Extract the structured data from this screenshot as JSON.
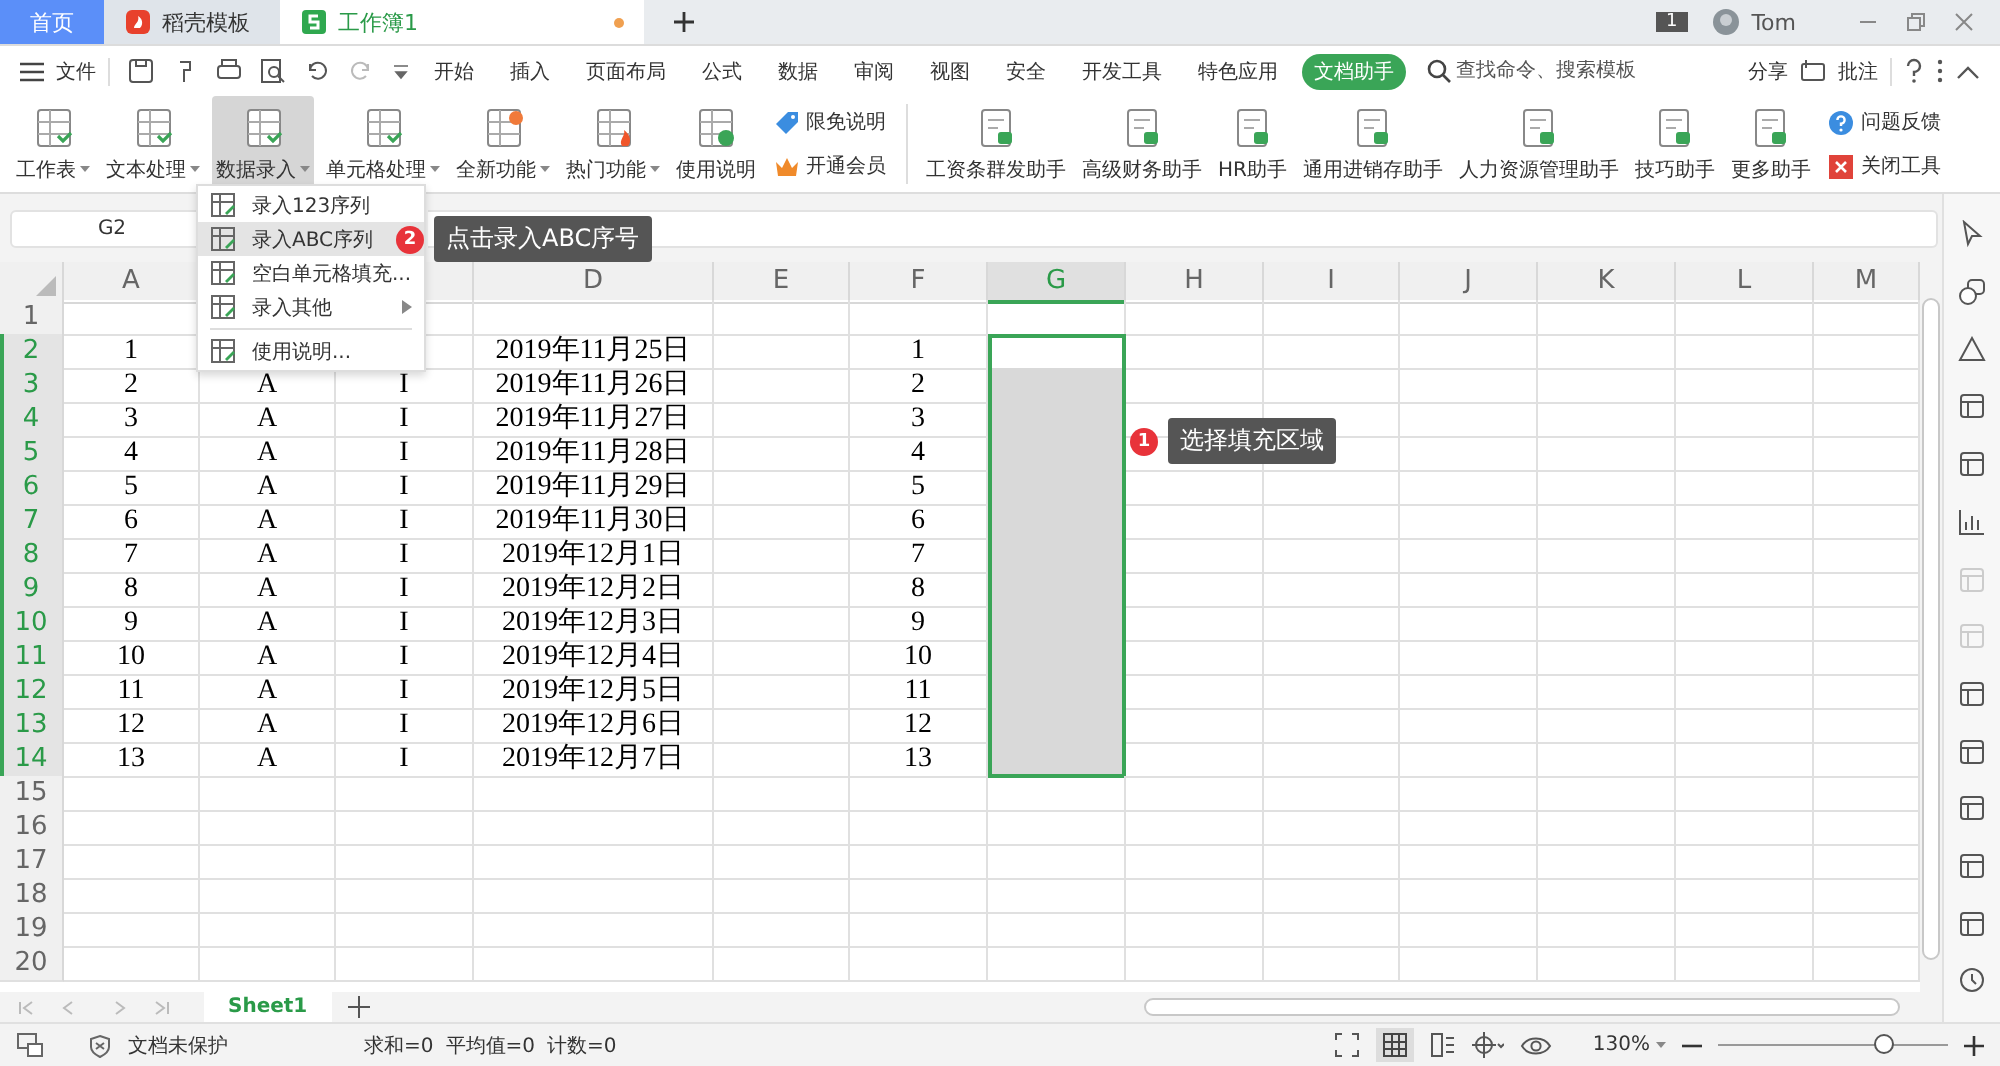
{
  "tabs": [
    {
      "label": "首页",
      "kind": "home",
      "selected": false,
      "modified": false
    },
    {
      "label": "稻壳模板",
      "kind": "docer",
      "selected": false,
      "modified": false
    },
    {
      "label": "工作簿1",
      "kind": "sheet",
      "selected": true,
      "modified": true
    }
  ],
  "account": {
    "badge": "1",
    "name": "Tom"
  },
  "menu": {
    "file": "文件",
    "items": [
      {
        "label": "开始",
        "selected": false
      },
      {
        "label": "插入",
        "selected": false
      },
      {
        "label": "页面布局",
        "selected": false
      },
      {
        "label": "公式",
        "selected": false
      },
      {
        "label": "数据",
        "selected": false
      },
      {
        "label": "审阅",
        "selected": false
      },
      {
        "label": "视图",
        "selected": false
      },
      {
        "label": "安全",
        "selected": false
      },
      {
        "label": "开发工具",
        "selected": false
      },
      {
        "label": "特色应用",
        "selected": false
      },
      {
        "label": "文档助手",
        "selected": true
      }
    ],
    "search_placeholder": "查找命令、搜索模板",
    "share": "分享",
    "comment": "批注"
  },
  "ribbon": {
    "tools": [
      {
        "label": "工作表",
        "dropdown": true,
        "selected": false
      },
      {
        "label": "文本处理",
        "dropdown": true,
        "selected": false
      },
      {
        "label": "数据录入",
        "dropdown": true,
        "selected": true
      },
      {
        "label": "单元格处理",
        "dropdown": true,
        "selected": false
      },
      {
        "label": "全新功能",
        "dropdown": true,
        "selected": false
      },
      {
        "label": "热门功能",
        "dropdown": true,
        "selected": false
      },
      {
        "label": "使用说明",
        "dropdown": false,
        "selected": false
      }
    ],
    "links": [
      "限免说明",
      "开通会员"
    ],
    "helpers": [
      "工资条群发助手",
      "高级财务助手",
      "HR助手",
      "通用进销存助手",
      "人力资源管理助手",
      "技巧助手",
      "更多助手"
    ],
    "extra": [
      "问题反馈",
      "关闭工具"
    ]
  },
  "dropdown": [
    {
      "label": "录入123序列",
      "selected": false,
      "submenu": false
    },
    {
      "label": "录入ABC序列",
      "selected": true,
      "submenu": false
    },
    {
      "label": "空白单元格填充...",
      "selected": false,
      "submenu": false
    },
    {
      "label": "录入其他",
      "selected": false,
      "submenu": true
    },
    {
      "label": "使用说明...",
      "selected": false,
      "submenu": false
    }
  ],
  "name_box": "G2",
  "columns": [
    {
      "label": "A",
      "selected": false
    },
    {},
    {},
    {
      "label": "D",
      "selected": false
    },
    {
      "label": "E",
      "selected": false
    },
    {
      "label": "F",
      "selected": false
    },
    {
      "label": "G",
      "selected": true
    },
    {
      "label": "H",
      "selected": false
    },
    {
      "label": "I",
      "selected": false
    },
    {
      "label": "J",
      "selected": false
    },
    {
      "label": "K",
      "selected": false
    },
    {
      "label": "L",
      "selected": false
    },
    {
      "label": "M",
      "selected": false
    }
  ],
  "rows": [
    {
      "number": "1",
      "selected": false,
      "cells": {}
    },
    {
      "number": "2",
      "selected": true,
      "cells": {
        "A": "1",
        "D": "2019年11月25日",
        "F": "1"
      }
    },
    {
      "number": "3",
      "selected": true,
      "cells": {
        "A": "2",
        "B": "A",
        "C": "I",
        "D": "2019年11月26日",
        "F": "2"
      }
    },
    {
      "number": "4",
      "selected": true,
      "cells": {
        "A": "3",
        "B": "A",
        "C": "I",
        "D": "2019年11月27日",
        "F": "3"
      }
    },
    {
      "number": "5",
      "selected": true,
      "cells": {
        "A": "4",
        "B": "A",
        "C": "I",
        "D": "2019年11月28日",
        "F": "4"
      }
    },
    {
      "number": "6",
      "selected": true,
      "cells": {
        "A": "5",
        "B": "A",
        "C": "I",
        "D": "2019年11月29日",
        "F": "5"
      }
    },
    {
      "number": "7",
      "selected": true,
      "cells": {
        "A": "6",
        "B": "A",
        "C": "I",
        "D": "2019年11月30日",
        "F": "6"
      }
    },
    {
      "number": "8",
      "selected": true,
      "cells": {
        "A": "7",
        "B": "A",
        "C": "I",
        "D": "2019年12月1日",
        "F": "7"
      }
    },
    {
      "number": "9",
      "selected": true,
      "cells": {
        "A": "8",
        "B": "A",
        "C": "I",
        "D": "2019年12月2日",
        "F": "8"
      }
    },
    {
      "number": "10",
      "selected": true,
      "cells": {
        "A": "9",
        "B": "A",
        "C": "I",
        "D": "2019年12月3日",
        "F": "9"
      }
    },
    {
      "number": "11",
      "selected": true,
      "cells": {
        "A": "10",
        "B": "A",
        "C": "I",
        "D": "2019年12月4日",
        "F": "10"
      }
    },
    {
      "number": "12",
      "selected": true,
      "cells": {
        "A": "11",
        "B": "A",
        "C": "I",
        "D": "2019年12月5日",
        "F": "11"
      }
    },
    {
      "number": "13",
      "selected": true,
      "cells": {
        "A": "12",
        "B": "A",
        "C": "I",
        "D": "2019年12月6日",
        "F": "12"
      }
    },
    {
      "number": "14",
      "selected": true,
      "cells": {
        "A": "13",
        "B": "A",
        "C": "I",
        "D": "2019年12月7日",
        "F": "13"
      }
    },
    {
      "number": "15",
      "selected": false,
      "cells": {}
    },
    {
      "number": "16",
      "selected": false,
      "cells": {}
    },
    {
      "number": "17",
      "selected": false,
      "cells": {}
    },
    {
      "number": "18",
      "selected": false,
      "cells": {}
    },
    {
      "number": "19",
      "selected": false,
      "cells": {}
    },
    {
      "number": "20",
      "selected": false,
      "cells": {}
    }
  ],
  "callouts": [
    {
      "number": "2",
      "text": "点击录入ABC序号"
    },
    {
      "number": "1",
      "text": "选择填充区域"
    }
  ],
  "sheet_tabs": [
    {
      "label": "Sheet1",
      "selected": true
    }
  ],
  "status": {
    "protection": "文档未保护",
    "sum": "求和=0",
    "average": "平均值=0",
    "count": "计数=0",
    "zoom": "130%",
    "zoom_slider": {
      "level": 0.72
    }
  }
}
